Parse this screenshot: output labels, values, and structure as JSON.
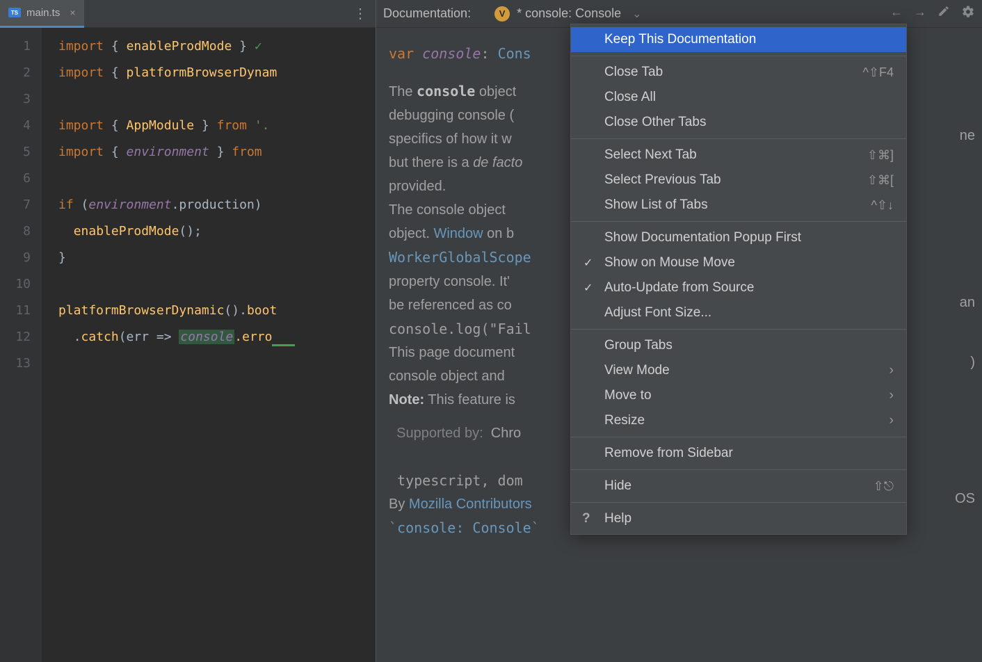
{
  "tab": {
    "filename": "main.ts",
    "icon_label": "TS"
  },
  "gutter": [
    "1",
    "2",
    "3",
    "4",
    "5",
    "6",
    "7",
    "8",
    "9",
    "10",
    "11",
    "12",
    "13"
  ],
  "code": {
    "l1_kw": "import",
    "l1_brace_open": "{ ",
    "l1_id": "enableProdMode",
    "l1_brace_close": " }",
    "l2_kw": "import",
    "l2_id": "platformBrowserDynam",
    "l4_kw": "import",
    "l4_id": "AppModule",
    "l4_from": "from",
    "l4_str": "'.",
    "l5_kw": "import",
    "l5_id": "environment",
    "l5_from": "from",
    "l7_kw": "if",
    "l7_env": "environment",
    "l7_prod": ".production)",
    "l8_fn": "enableProdMode",
    "l8_call": "();",
    "l9_brace": "}",
    "l11_call1": "platformBrowserDynamic",
    "l11_dot": "().",
    "l11_call2": "boot",
    "l12_dot": ".",
    "l12_catch": "catch",
    "l12_err": "(err => ",
    "l12_console": "console",
    "l12_error": ".erro"
  },
  "doc": {
    "header_title": "Documentation:",
    "modified_label": "* console: Console",
    "sig_var": "var",
    "sig_name": "console",
    "sig_colon": ": ",
    "sig_type": "Cons",
    "p1_a": "The ",
    "p1_bold": "console",
    "p1_b": " object provides access to the browser's debugging console (e.g. the Web Console in Firefox). The specifics of how it works varies from browser to browser, but there is a ",
    "p1_italic": "de facto",
    "p1_c": " set of features that are typically provided.",
    "p2_a": "The console object can be accessed from any global object. ",
    "p2_link1": "Window",
    "p2_b": " on browsing scopes and ",
    "p2_link2": "WorkerGlobalScope",
    "p2_c": " as specific variants in workers via the property console. It's exposed as Window.console, and can be referenced as console. For example:",
    "code_ex": "console.log(\"Failed to open the specified link\")",
    "p3": "This page documents the Methods available on the console object and gives a few Usage examples.",
    "note_label": "Note:",
    "note_text": " This feature is available in Web Workers.",
    "supported_label": "Supported by:",
    "supported_text": "Chrome 1, Edge 12, Firefox 4, Opera 10.5, Safari 3, Chrome Android, IE 8, Safari iOS",
    "libs": "typescript, dom",
    "by": "By ",
    "by_link": "Mozilla Contributors",
    "backtick": "`",
    "console_code": "console: Console",
    "far_right_1": "ne",
    "far_right_2": "an",
    "far_right_3": ")",
    "far_right_4": "OS"
  },
  "menu": {
    "items": [
      {
        "label": "Keep This Documentation",
        "highlighted": true
      },
      {
        "sep": true
      },
      {
        "label": "Close Tab",
        "shortcut": "^⇧F4"
      },
      {
        "label": "Close All"
      },
      {
        "label": "Close Other Tabs"
      },
      {
        "sep": true
      },
      {
        "label": "Select Next Tab",
        "shortcut": "⇧⌘]"
      },
      {
        "label": "Select Previous Tab",
        "shortcut": "⇧⌘["
      },
      {
        "label": "Show List of Tabs",
        "shortcut": "^⇧↓"
      },
      {
        "sep": true
      },
      {
        "label": "Show Documentation Popup First"
      },
      {
        "label": "Show on Mouse Move",
        "checked": true
      },
      {
        "label": "Auto-Update from Source",
        "checked": true
      },
      {
        "label": "Adjust Font Size..."
      },
      {
        "sep": true
      },
      {
        "label": "Group Tabs"
      },
      {
        "label": "View Mode",
        "submenu": true
      },
      {
        "label": "Move to",
        "submenu": true
      },
      {
        "label": "Resize",
        "submenu": true
      },
      {
        "sep": true
      },
      {
        "label": "Remove from Sidebar"
      },
      {
        "sep": true
      },
      {
        "label": "Hide",
        "shortcut": "⇧⎋"
      },
      {
        "sep": true
      },
      {
        "label": "Help",
        "help_icon": true
      }
    ]
  }
}
